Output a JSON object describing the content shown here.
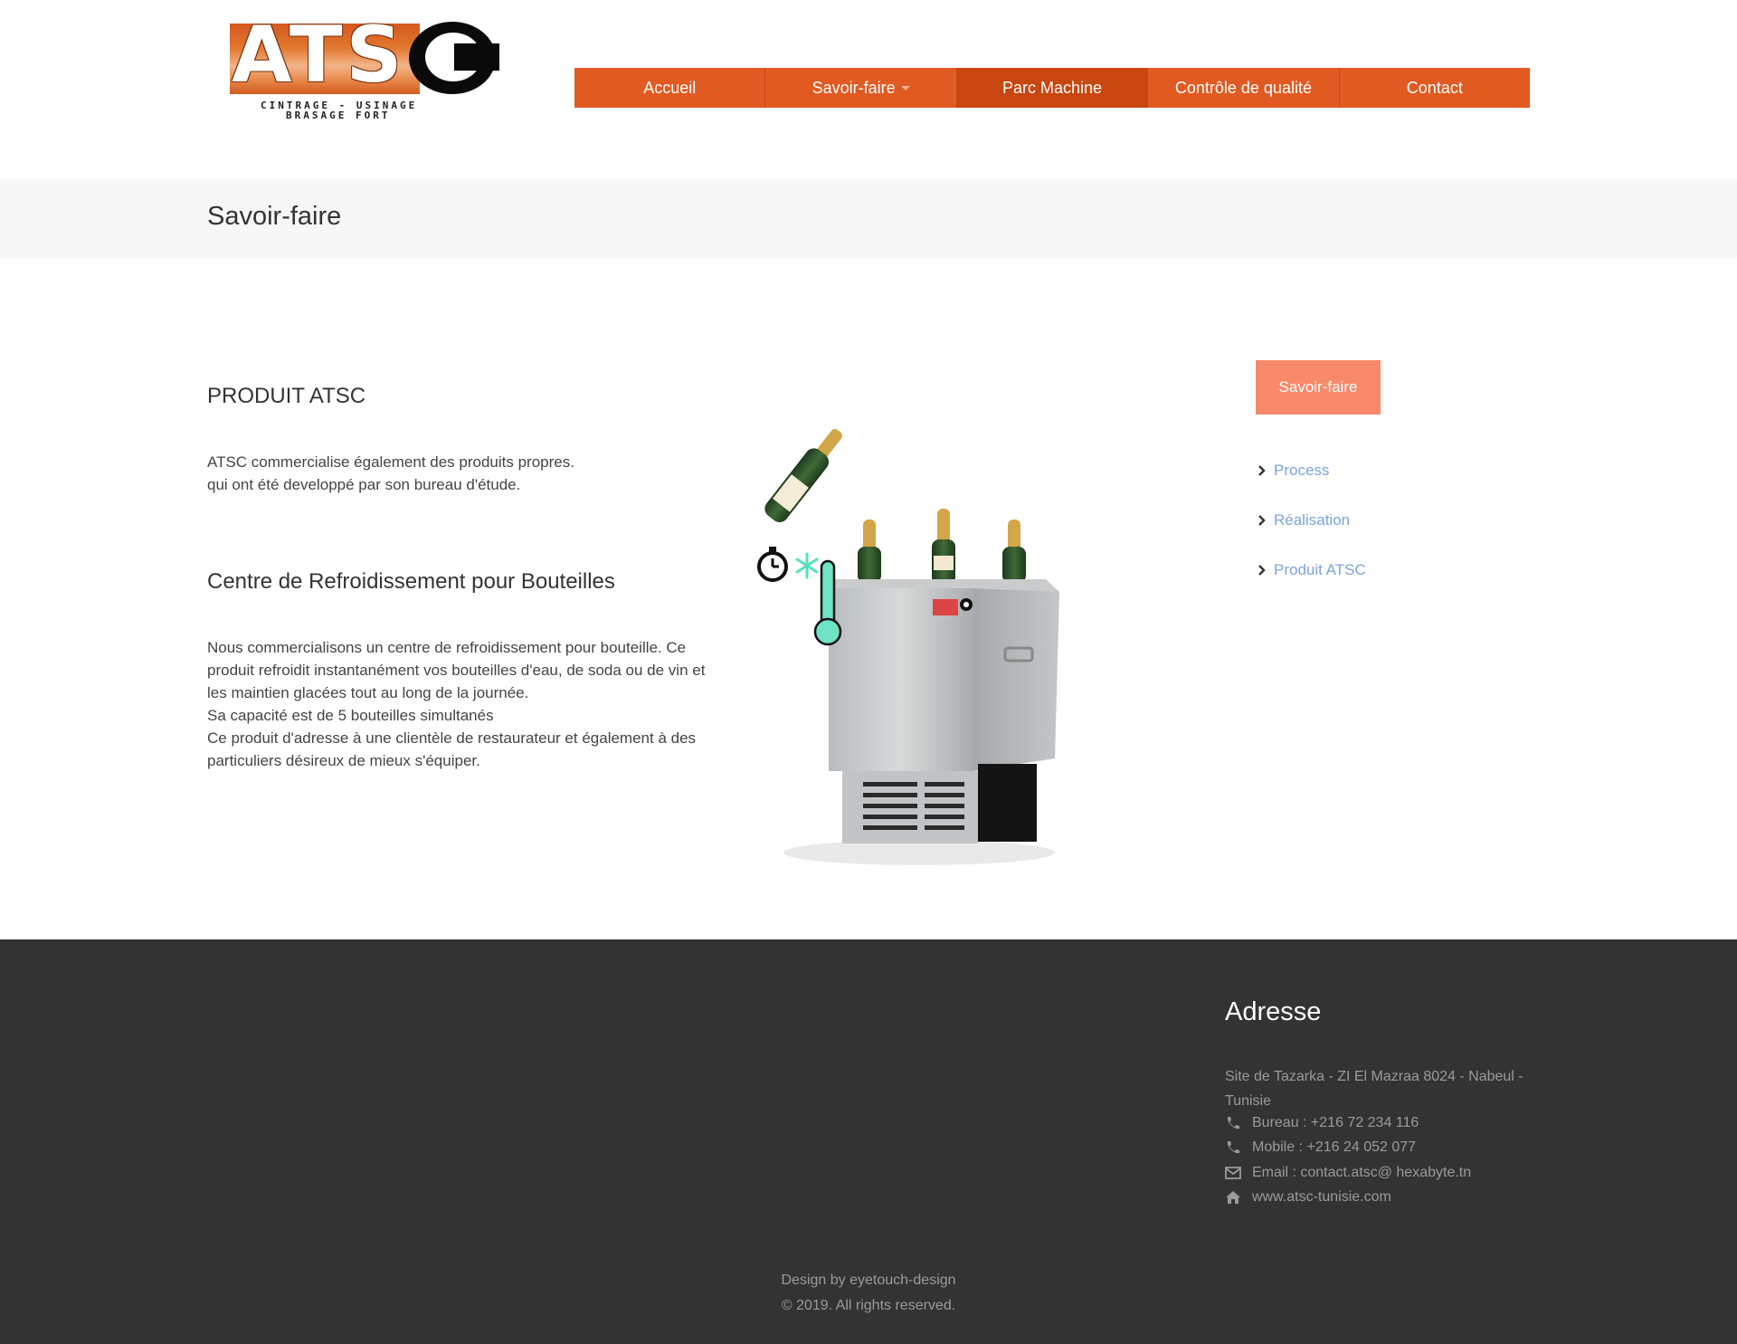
{
  "logo": {
    "letters": "ATS",
    "tagline_1": "CINTRAGE - USINAGE",
    "tagline_2": "BRASAGE FORT"
  },
  "nav": {
    "items": [
      {
        "label": "Accueil"
      },
      {
        "label": "Savoir-faire"
      },
      {
        "label": "Parc Machine"
      },
      {
        "label": "Contrôle de qualité"
      },
      {
        "label": "Contact"
      }
    ],
    "active": "Parc Machine"
  },
  "page": {
    "title": "Savoir-faire"
  },
  "main": {
    "product_heading": "PRODUIT ATSC",
    "intro_lines": [
      "ATSC commercialise également des produits propres.",
      "qui ont été developpé par son bureau d'étude."
    ],
    "section_heading": "Centre de Refroidissement pour Bouteilles",
    "description_lines": [
      "Nous commercialisons un centre de refroidissement pour bouteille. Ce",
      "produit refroidit instantanément vos bouteilles d'eau, de soda ou de vin et",
      "les maintien glacées tout au long de la journée.",
      "Sa capacité est de 5 bouteilles simultanés",
      "Ce produit d'adresse à une clientèle de restaurateur et également à des",
      "particuliers désireux de mieux s'équiper."
    ]
  },
  "sidebar": {
    "button_label": "Savoir-faire",
    "links": [
      {
        "label": "Process"
      },
      {
        "label": "Réalisation"
      },
      {
        "label": "Produit ATSC"
      }
    ]
  },
  "footer": {
    "address_title": "Adresse",
    "address_text": "Site de Tazarka - ZI El Mazraa 8024 - Nabeul - Tunisie",
    "bureau": "Bureau : +216 72 234 116",
    "mobile": "Mobile : +216 24 052 077",
    "email": "Email : contact.atsc@ hexabyte.tn",
    "website": "www.atsc-tunisie.com",
    "credit_1": "Design by eyetouch-design",
    "credit_2": "© 2019. All rights reserved."
  },
  "colors": {
    "nav_bg": "#e05a22",
    "nav_active": "#c8460f",
    "side_button": "#f7896a",
    "link": "#7fa3d8",
    "footer_bg": "#333333"
  },
  "icons": {
    "nav_dropdown": "caret-down-icon",
    "side_link": "chevron-right-icon",
    "phone": "phone-icon",
    "email": "envelope-icon",
    "website": "home-icon"
  }
}
